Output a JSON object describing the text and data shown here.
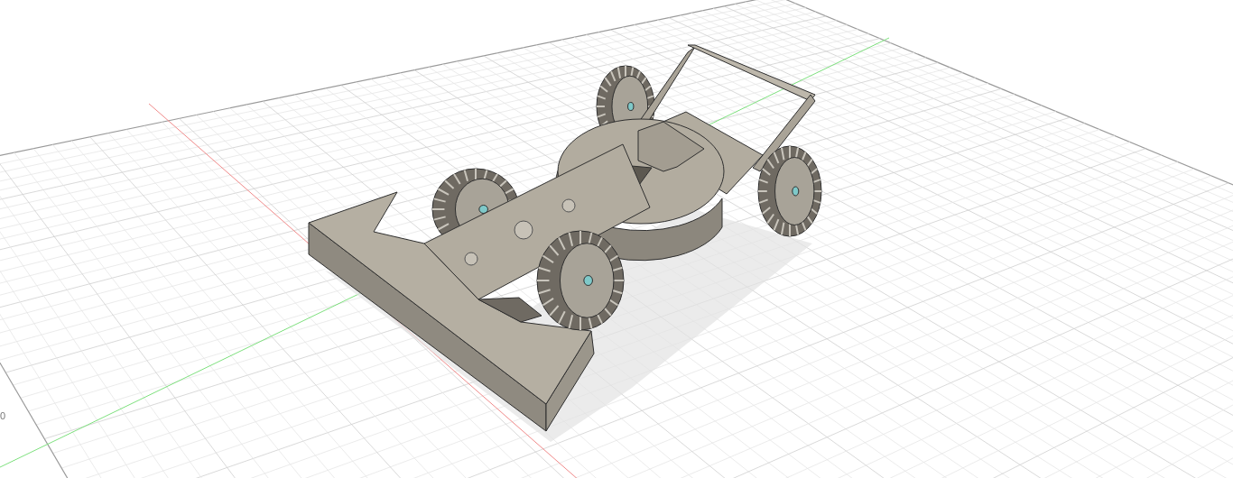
{
  "viewport": {
    "grid_labels": [
      "0"
    ]
  }
}
